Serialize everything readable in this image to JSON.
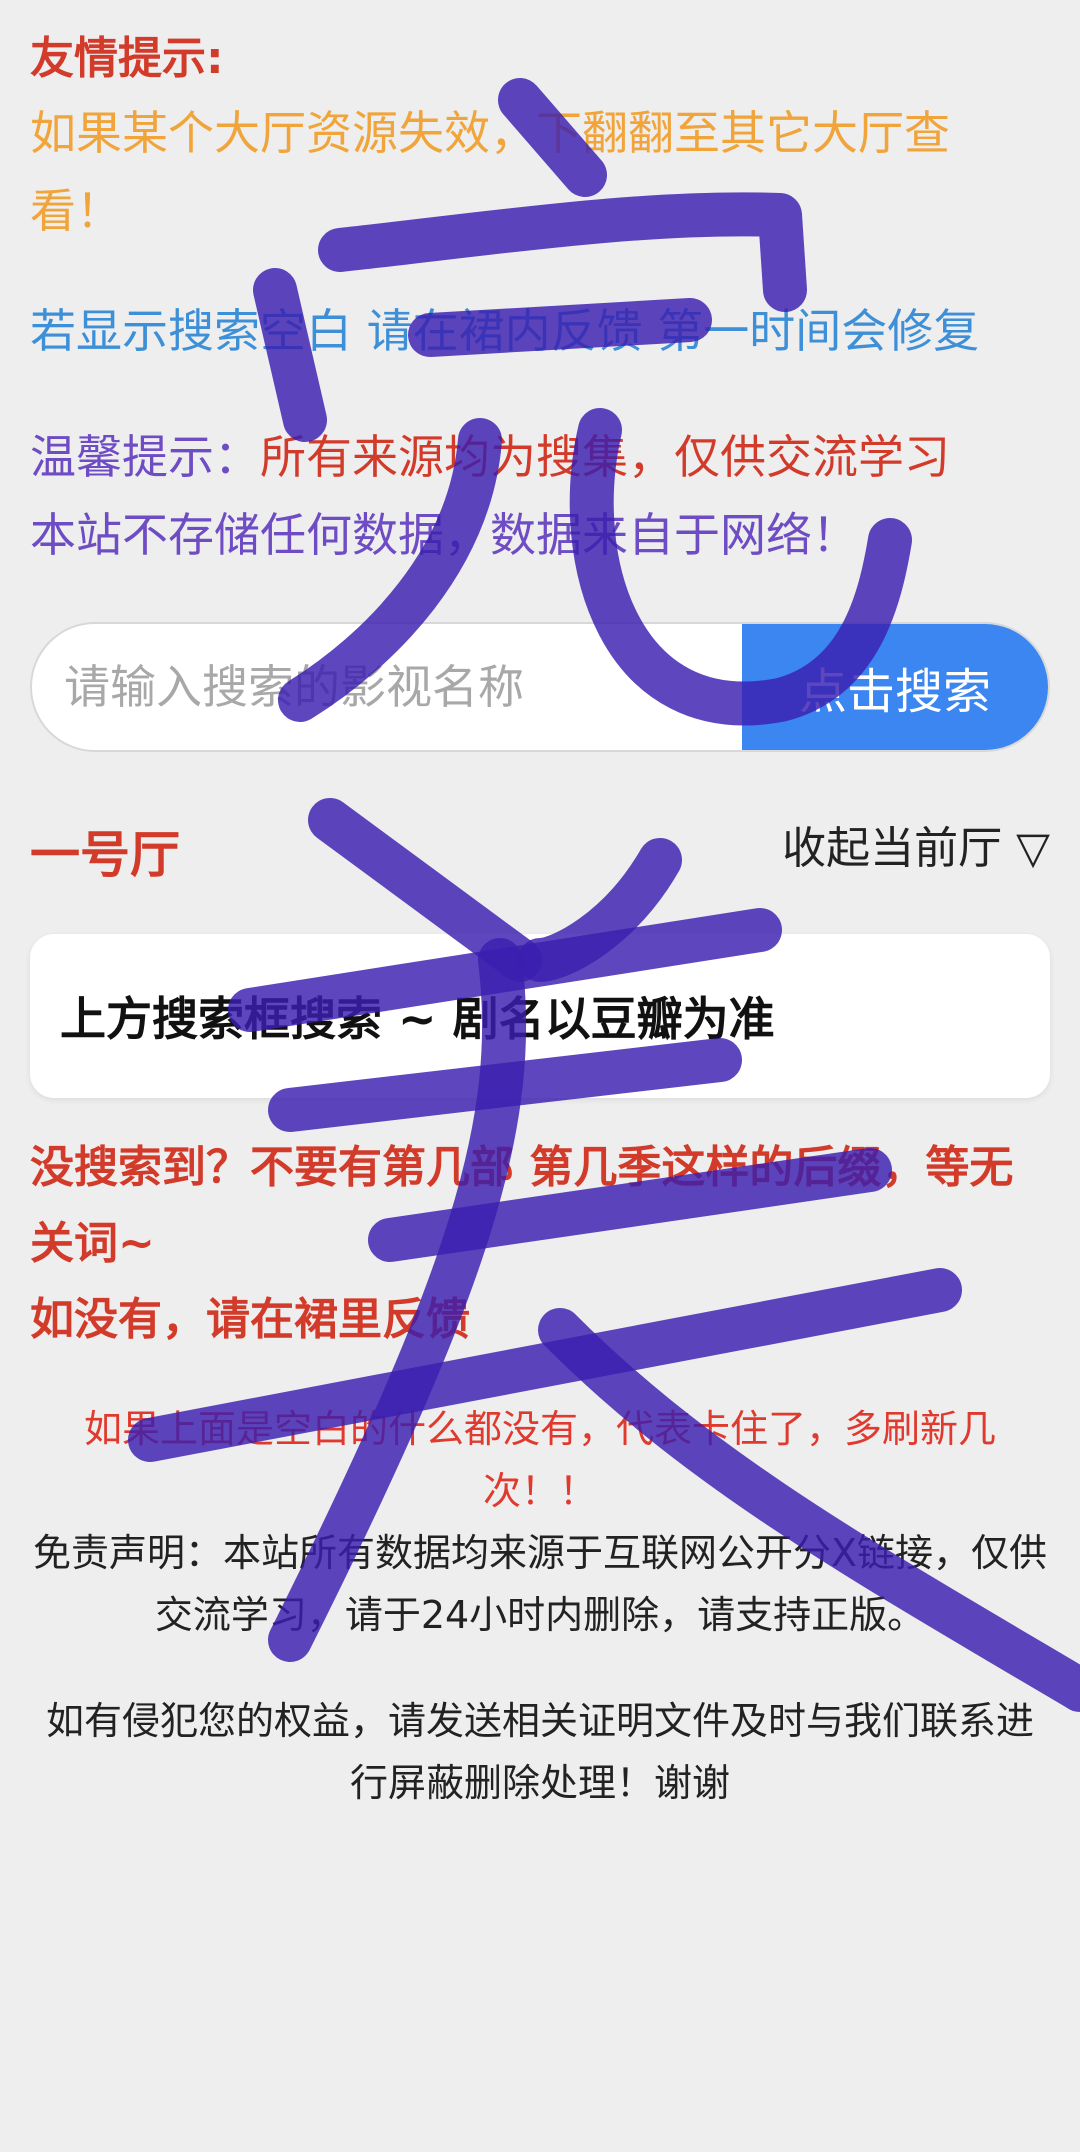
{
  "tips": {
    "title": "友情提示:",
    "line1": "如果某个大厅资源失效，下翻翻至其它大厅查看！",
    "line2": "若显示搜索空白 请在裙内反馈 第一时间会修复",
    "warm_label": "温馨提示：",
    "warm_text": "所有来源均为搜集，仅供交流学习",
    "line4": "本站不存储任何数据，数据来自于网络！"
  },
  "search": {
    "placeholder": "请输入搜索的影视名称",
    "button": "点击搜索"
  },
  "hall": {
    "title": "一号厅",
    "collapse_label": "收起当前厅 ▽"
  },
  "card": {
    "text": "上方搜索框搜索 ~ 剧名以豆瓣为准"
  },
  "notfound": {
    "line1": "没搜索到？不要有第几部 第几季这样的后缀，等无关词~",
    "line2": "如没有，请在裙里反馈"
  },
  "footer": {
    "blank_warning": "如果上面是空白的什么都没有，代表卡住了，多刷新几次！！",
    "disclaimer": "免责声明：本站所有数据均来源于互联网公开分X链接，仅供交流学习，请于24小时内删除，请支持正版。",
    "infringe": "如有侵犯您的权益，请发送相关证明文件及时与我们联系进行屏蔽删除处理！谢谢"
  },
  "overlay": {
    "handwriting": "完美",
    "color": "#3a1fb0"
  },
  "colors": {
    "red": "#d23a2a",
    "orange": "#f0a43a",
    "blue": "#3d8fd8",
    "purple": "#6e4cc4",
    "search_button": "#3b86f0",
    "background": "#eeeeee"
  }
}
